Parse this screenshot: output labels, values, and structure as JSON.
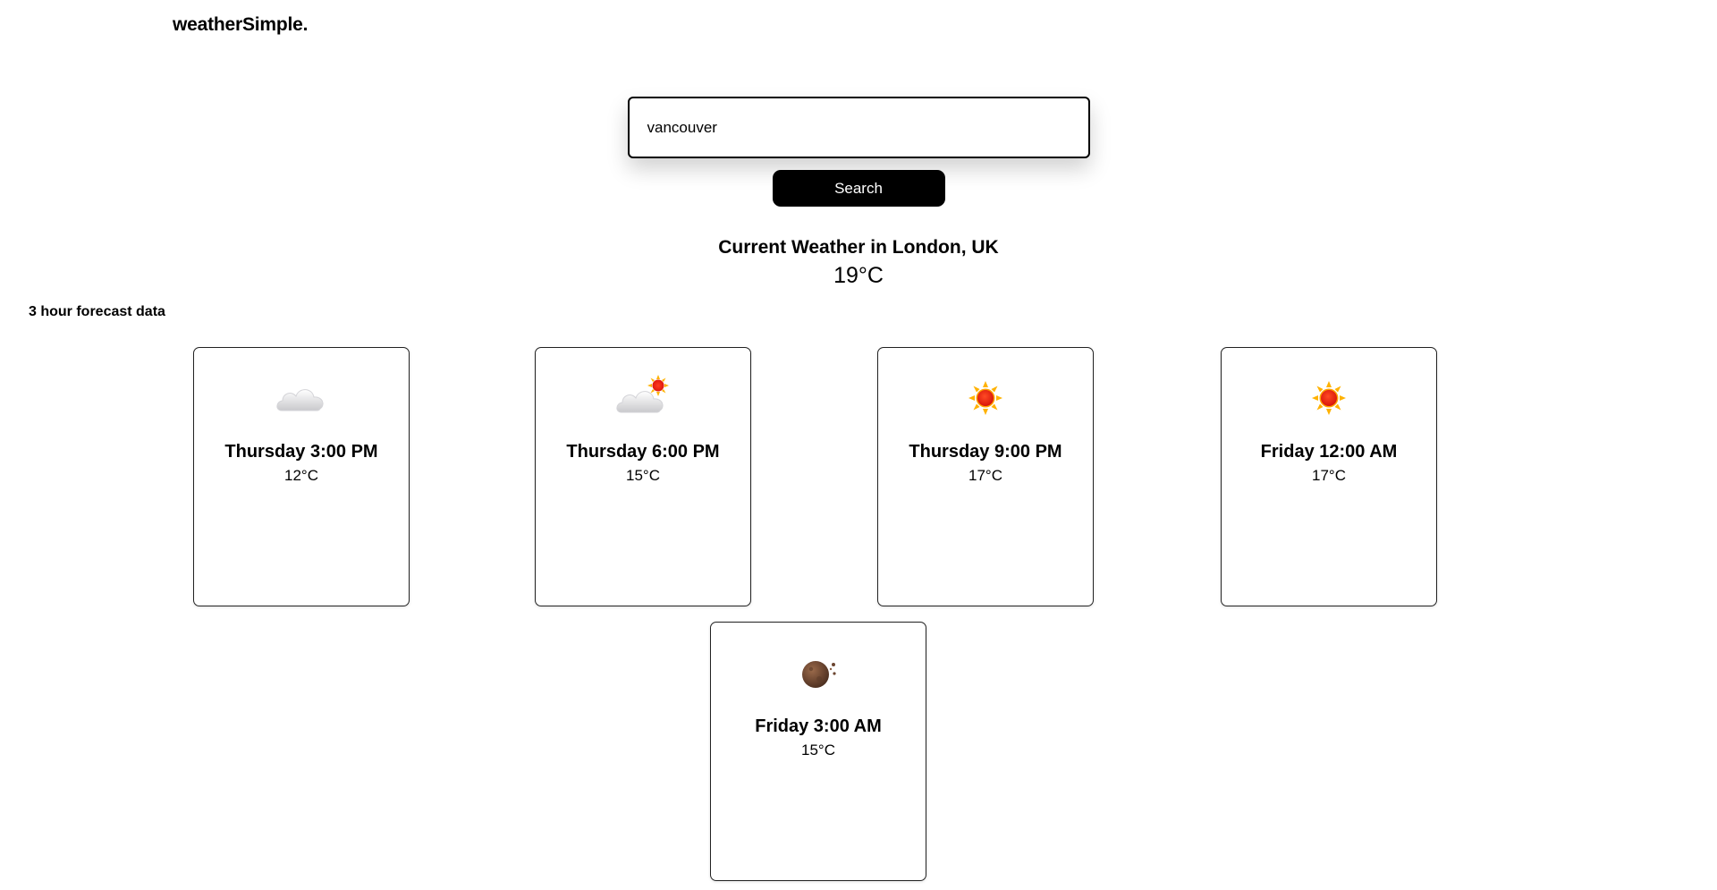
{
  "app": {
    "logo": "weatherSimple."
  },
  "search": {
    "value": "vancouver",
    "button_label": "Search"
  },
  "current": {
    "title": "Current Weather in London, UK",
    "temperature": "19°C"
  },
  "forecast": {
    "heading": "3 hour forecast data",
    "cards": [
      {
        "time": "Thursday 3:00 PM",
        "temperature": "12°C",
        "icon": "cloud-icon"
      },
      {
        "time": "Thursday 6:00 PM",
        "temperature": "15°C",
        "icon": "partly-cloudy-icon"
      },
      {
        "time": "Thursday 9:00 PM",
        "temperature": "17°C",
        "icon": "sun-icon"
      },
      {
        "time": "Friday 12:00 AM",
        "temperature": "17°C",
        "icon": "sun-icon"
      },
      {
        "time": "Friday 3:00 AM",
        "temperature": "15°C",
        "icon": "moon-icon"
      }
    ]
  }
}
